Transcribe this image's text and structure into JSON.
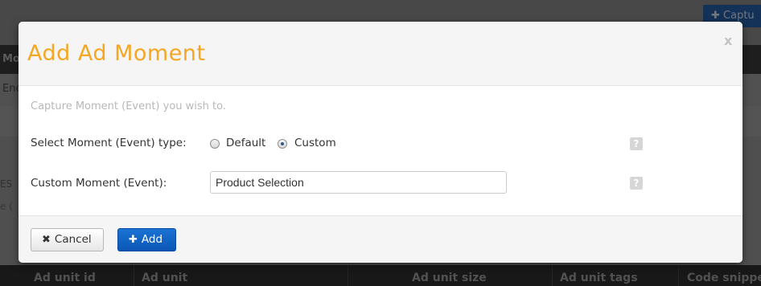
{
  "background": {
    "capture_button_label": "Captu",
    "header_fragment": "Mo",
    "row_fragment": "End",
    "side_fragment_1": "ES",
    "side_fragment_2": "e (",
    "table_headers": [
      "Ad unit id",
      "Ad unit",
      "Ad unit size",
      "Ad unit tags",
      "Code snippe"
    ]
  },
  "modal": {
    "title": "Add Ad Moment",
    "close_label": "x",
    "intro": "Capture Moment (Event) you wish to.",
    "type_label": "Select Moment (Event) type:",
    "radio_default_label": "Default",
    "radio_custom_label": "Custom",
    "selected_type": "Custom",
    "custom_label": "Custom Moment (Event):",
    "custom_value": "Product Selection",
    "help_glyph": "?",
    "cancel_label": "Cancel",
    "add_label": "Add",
    "cancel_glyph": "✖",
    "add_glyph": "✚"
  },
  "icons": {
    "cancel": "x-icon",
    "add": "plus-icon",
    "help": "question-mark-icon"
  },
  "colors": {
    "title": "#f5a623",
    "primary_button": "#0b56b5"
  }
}
